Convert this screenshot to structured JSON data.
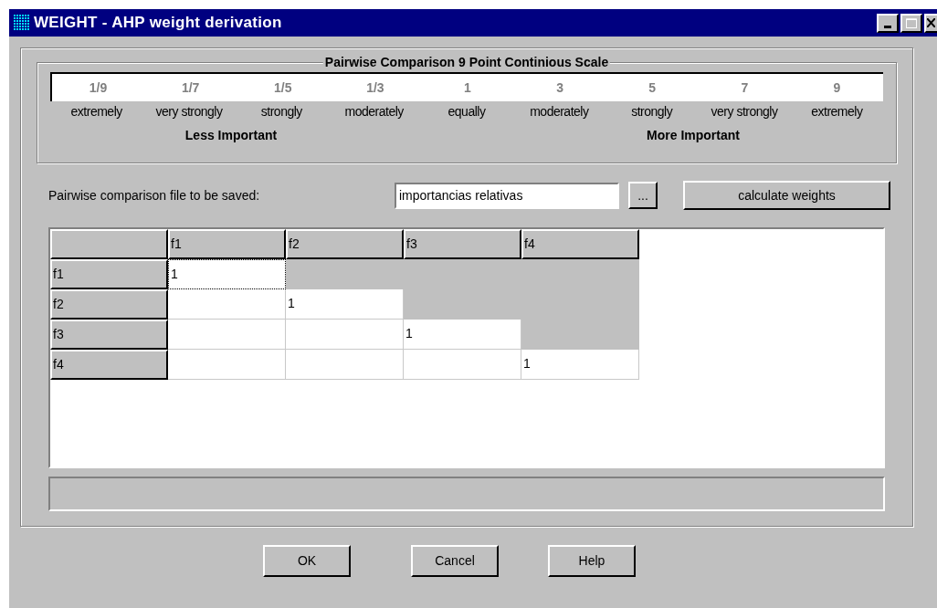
{
  "window": {
    "title": "WEIGHT - AHP weight derivation"
  },
  "scale": {
    "title": "Pairwise Comparison 9 Point Continious Scale",
    "points": [
      {
        "value": "1/9",
        "label": "extremely"
      },
      {
        "value": "1/7",
        "label": "very strongly"
      },
      {
        "value": "1/5",
        "label": "strongly"
      },
      {
        "value": "1/3",
        "label": "moderately"
      },
      {
        "value": "1",
        "label": "equally"
      },
      {
        "value": "3",
        "label": "moderately"
      },
      {
        "value": "5",
        "label": "strongly"
      },
      {
        "value": "7",
        "label": "very strongly"
      },
      {
        "value": "9",
        "label": "extremely"
      }
    ],
    "left_caption": "Less Important",
    "right_caption": "More Important"
  },
  "file": {
    "label": "Pairwise comparison file to be saved:",
    "value": "importancias relativas",
    "browse_button": "...",
    "calculate_button": "calculate weights"
  },
  "grid": {
    "columns": [
      "f1",
      "f2",
      "f3",
      "f4"
    ],
    "rows": [
      {
        "header": "f1",
        "cells": [
          {
            "value": "1",
            "editable": true,
            "focused": true
          },
          {
            "editable": false,
            "focused": false
          },
          {
            "editable": false,
            "focused": false
          },
          {
            "editable": false,
            "focused": false
          }
        ]
      },
      {
        "header": "f2",
        "cells": [
          {
            "editable": true,
            "focused": false
          },
          {
            "value": "1",
            "editable": true,
            "focused": false
          },
          {
            "editable": false,
            "focused": false
          },
          {
            "editable": false,
            "focused": false
          }
        ]
      },
      {
        "header": "f3",
        "cells": [
          {
            "editable": true,
            "focused": false
          },
          {
            "editable": true,
            "focused": false
          },
          {
            "value": "1",
            "editable": true,
            "focused": false
          },
          {
            "editable": false,
            "focused": false
          }
        ]
      },
      {
        "header": "f4",
        "cells": [
          {
            "editable": true,
            "focused": false
          },
          {
            "editable": true,
            "focused": false
          },
          {
            "editable": true,
            "focused": false
          },
          {
            "value": "1",
            "editable": true,
            "focused": false
          }
        ]
      }
    ]
  },
  "buttons": [
    "OK",
    "Cancel",
    "Help"
  ]
}
